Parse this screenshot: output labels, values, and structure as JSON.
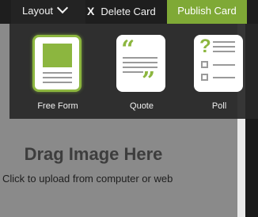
{
  "toolbar": {
    "layout_label": "Layout",
    "delete_label": "Delete Card",
    "delete_icon": "X",
    "publish_label": "Publish Card"
  },
  "layout_menu": {
    "options": [
      {
        "label": "Free Form",
        "icon": "free-form-layout-icon",
        "selected": true
      },
      {
        "label": "Quote",
        "icon": "quote-layout-icon",
        "selected": false
      },
      {
        "label": "Poll",
        "icon": "poll-layout-icon",
        "selected": false
      }
    ]
  },
  "editor": {
    "drag_title": "Drag Image Here",
    "drag_subtitle": "Click to upload from computer or web"
  },
  "colors": {
    "accent": "#7fa936",
    "toolbar_bg": "#1e1e1e",
    "editor_bg": "#8a8a8a"
  }
}
